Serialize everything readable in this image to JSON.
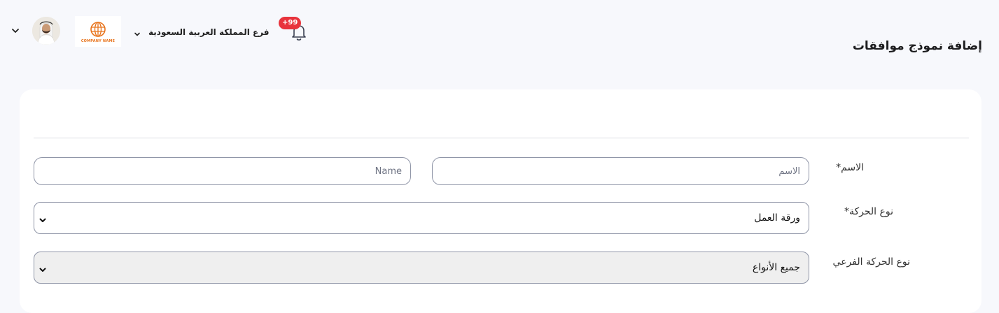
{
  "header": {
    "page_title": "إضافة نموذج موافقات",
    "branch_selector": {
      "label": "فرع المملكة العربية السعودية"
    },
    "notifications": {
      "badge": "+99"
    },
    "company_logo": {
      "text": "COMPANY NAME"
    },
    "avatar": {
      "icon": "user-avatar"
    }
  },
  "form": {
    "name_field": {
      "label": "الاسم",
      "required_mark": "*",
      "arabic_placeholder": "الاسم",
      "english_placeholder": "Name"
    },
    "movement_type": {
      "label": "نوع الحركة",
      "required_mark": "*",
      "selected": "ورقة العمل"
    },
    "sub_movement_type": {
      "label": "نوع الحركة الفرعي",
      "selected": "جميع الأنواع"
    }
  },
  "colors": {
    "background": "#f7f8fc",
    "badge": "#e8333c",
    "logo_accent": "#e8731b",
    "input_border": "#8f95a7"
  }
}
